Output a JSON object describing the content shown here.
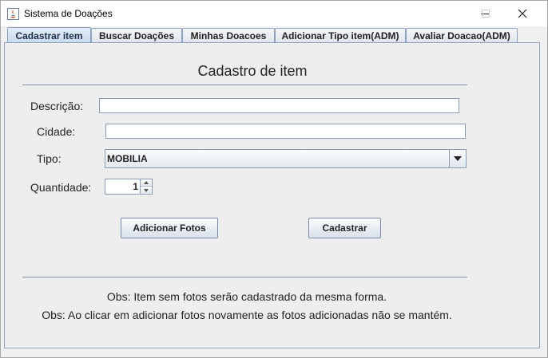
{
  "window": {
    "title": "Sistema de Doações",
    "minimize_icon": "minimize-icon",
    "maximize_icon": "maximize-icon",
    "close_icon": "close-icon"
  },
  "tabs": [
    {
      "label": "Cadastrar item",
      "selected": true
    },
    {
      "label": "Buscar Doações",
      "selected": false
    },
    {
      "label": "Minhas Doacoes",
      "selected": false
    },
    {
      "label": "Adicionar Tipo item(ADM)",
      "selected": false
    },
    {
      "label": "Avaliar Doacao(ADM)",
      "selected": false
    }
  ],
  "form": {
    "heading": "Cadastro de item",
    "descricao_label": "Descrição:",
    "descricao_value": "",
    "cidade_label": "Cidade:",
    "cidade_value": "",
    "tipo_label": "Tipo:",
    "tipo_value": "MOBILIA",
    "quantidade_label": "Quantidade:",
    "quantidade_value": "1",
    "add_photos_button": "Adicionar Fotos",
    "submit_button": "Cadastrar"
  },
  "notes": {
    "obs1": "Obs: Item sem fotos serão cadastrado da mesma forma.",
    "obs2": "Obs: Ao clicar em adicionar fotos novamente as fotos adicionadas não se mantém."
  },
  "colors": {
    "accent_border": "#8ea2bd",
    "panel_bg": "#eeeeee",
    "selected_tab": "#c8d8ef"
  }
}
